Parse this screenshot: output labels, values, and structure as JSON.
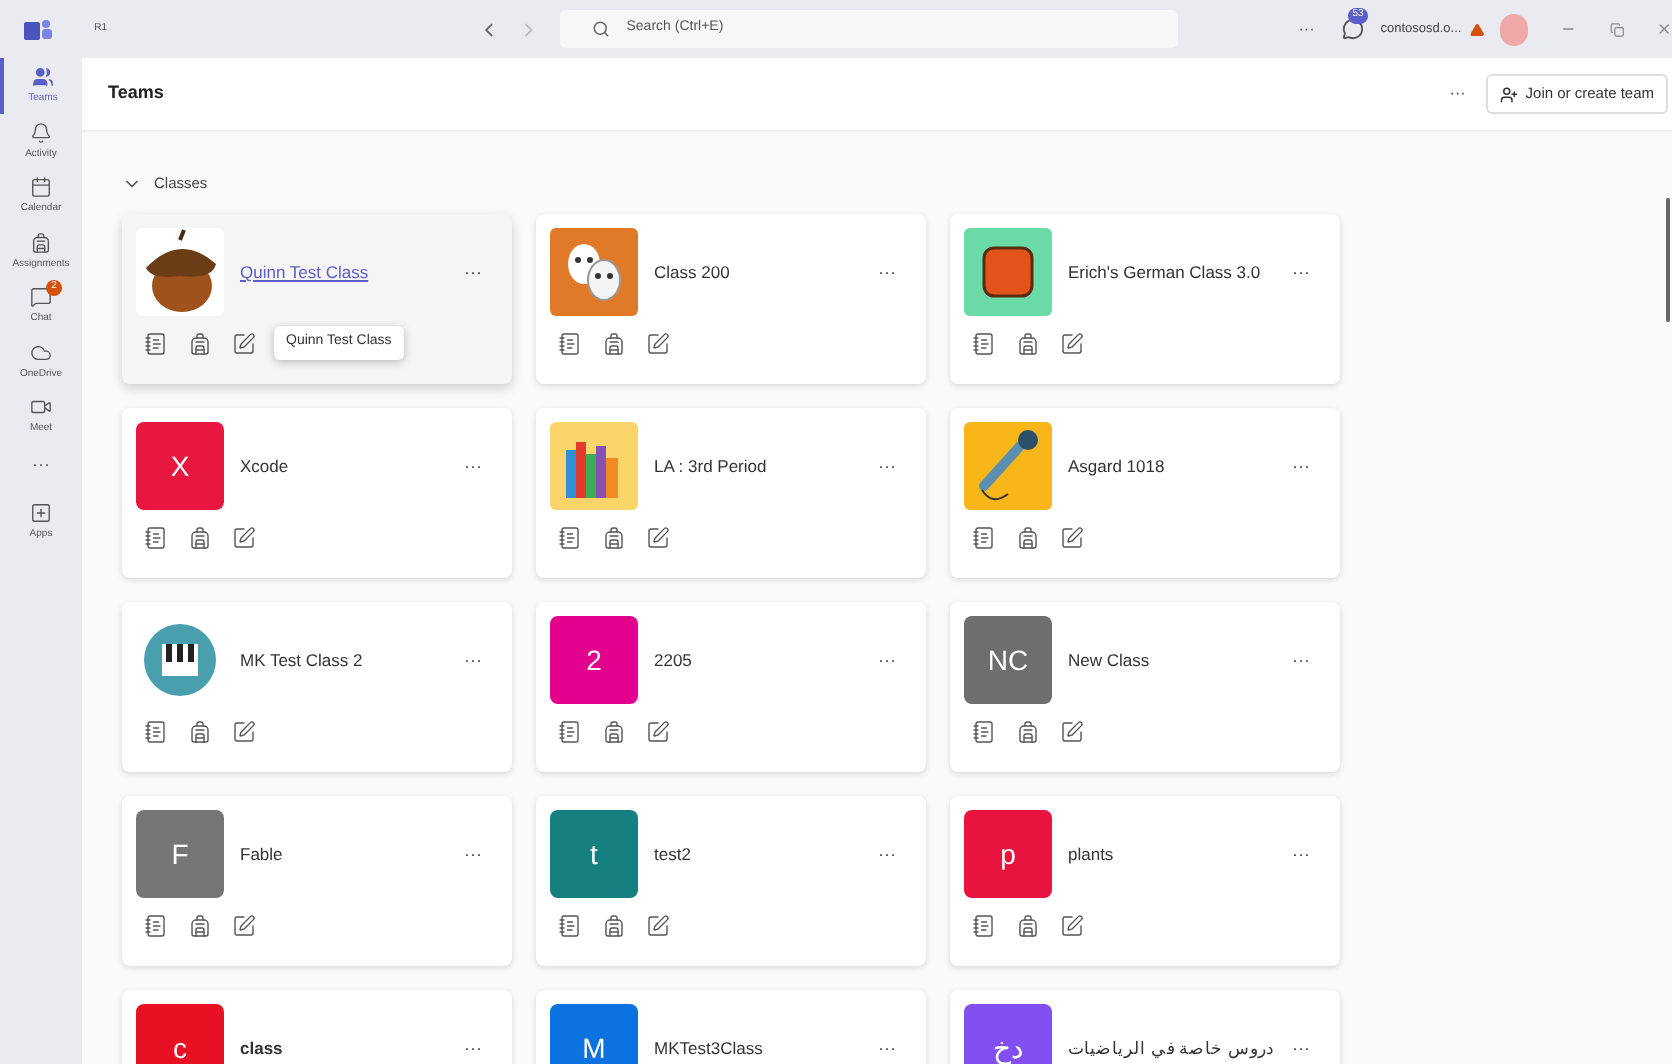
{
  "title_bar": {
    "app_label": "R1",
    "search": {
      "placeholder": "Search (Ctrl+E)"
    },
    "more": "···",
    "notification_badge": "53",
    "account": "contososd.o...",
    "warning": true
  },
  "rail": [
    {
      "label": "Teams",
      "kind": "teams",
      "selected": true
    },
    {
      "label": "Activity",
      "kind": "bell",
      "selected": false
    },
    {
      "label": "Calendar",
      "kind": "calendar",
      "selected": false
    },
    {
      "label": "Assignments",
      "kind": "backpack",
      "selected": false
    },
    {
      "label": "Chat",
      "kind": "chat",
      "selected": false,
      "badge": "2"
    },
    {
      "label": "OneDrive",
      "kind": "cloud",
      "selected": false
    },
    {
      "label": "Meet",
      "kind": "video",
      "selected": false
    },
    {
      "label": "···",
      "kind": "more",
      "selected": false
    },
    {
      "label": "Apps",
      "kind": "apps",
      "selected": false
    }
  ],
  "header": {
    "title": "Teams",
    "more": "···",
    "join_button": "Join or create team"
  },
  "section": {
    "label": "Classes",
    "expanded": true
  },
  "classes": [
    {
      "name": "Quinn Test Class",
      "kind": "acorn",
      "hovered": true,
      "bold": false,
      "more": "···",
      "tooltip": "Quinn Test Class"
    },
    {
      "name": "Class 200",
      "kind": "masks",
      "hovered": false,
      "bold": false,
      "more": "···"
    },
    {
      "name": "Erich's German Class 3.0",
      "kind": "tile",
      "hovered": false,
      "bold": false,
      "more": "···"
    },
    {
      "name": "Xcode",
      "kind": "letter",
      "letter": "X",
      "color": "#e8173f",
      "hovered": false,
      "bold": false,
      "more": "···"
    },
    {
      "name": "LA : 3rd Period",
      "kind": "books",
      "hovered": false,
      "bold": false,
      "more": "···"
    },
    {
      "name": "Asgard 1018",
      "kind": "microphone",
      "hovered": false,
      "bold": false,
      "more": "···"
    },
    {
      "name": "MK Test Class 2",
      "kind": "piano",
      "hovered": false,
      "bold": false,
      "more": "···"
    },
    {
      "name": "2205",
      "kind": "letter",
      "letter": "2",
      "color": "#e3008c",
      "hovered": false,
      "bold": false,
      "more": "···"
    },
    {
      "name": "New Class",
      "kind": "letter",
      "letter": "NC",
      "color": "#6e6e6e",
      "hovered": false,
      "bold": false,
      "more": "···"
    },
    {
      "name": "Fable",
      "kind": "letter",
      "letter": "F",
      "color": "#767676",
      "hovered": false,
      "bold": false,
      "more": "···"
    },
    {
      "name": "test2",
      "kind": "letter",
      "letter": "t",
      "color": "#167f7f",
      "hovered": false,
      "bold": false,
      "more": "···"
    },
    {
      "name": "plants",
      "kind": "letter",
      "letter": "p",
      "color": "#e8133e",
      "hovered": false,
      "bold": false,
      "more": "···"
    },
    {
      "name": "class",
      "kind": "letter",
      "letter": "c",
      "color": "#e81123",
      "hovered": false,
      "bold": true,
      "more": "···"
    },
    {
      "name": "MKTest3Class",
      "kind": "letter",
      "letter": "M",
      "color": "#0b72e0",
      "hovered": false,
      "bold": false,
      "more": "···"
    },
    {
      "name": "دروس خاصة في الرياضيات",
      "kind": "letter",
      "letter": "دخ",
      "color": "#8250f0",
      "hovered": false,
      "bold": false,
      "more": "···"
    }
  ]
}
